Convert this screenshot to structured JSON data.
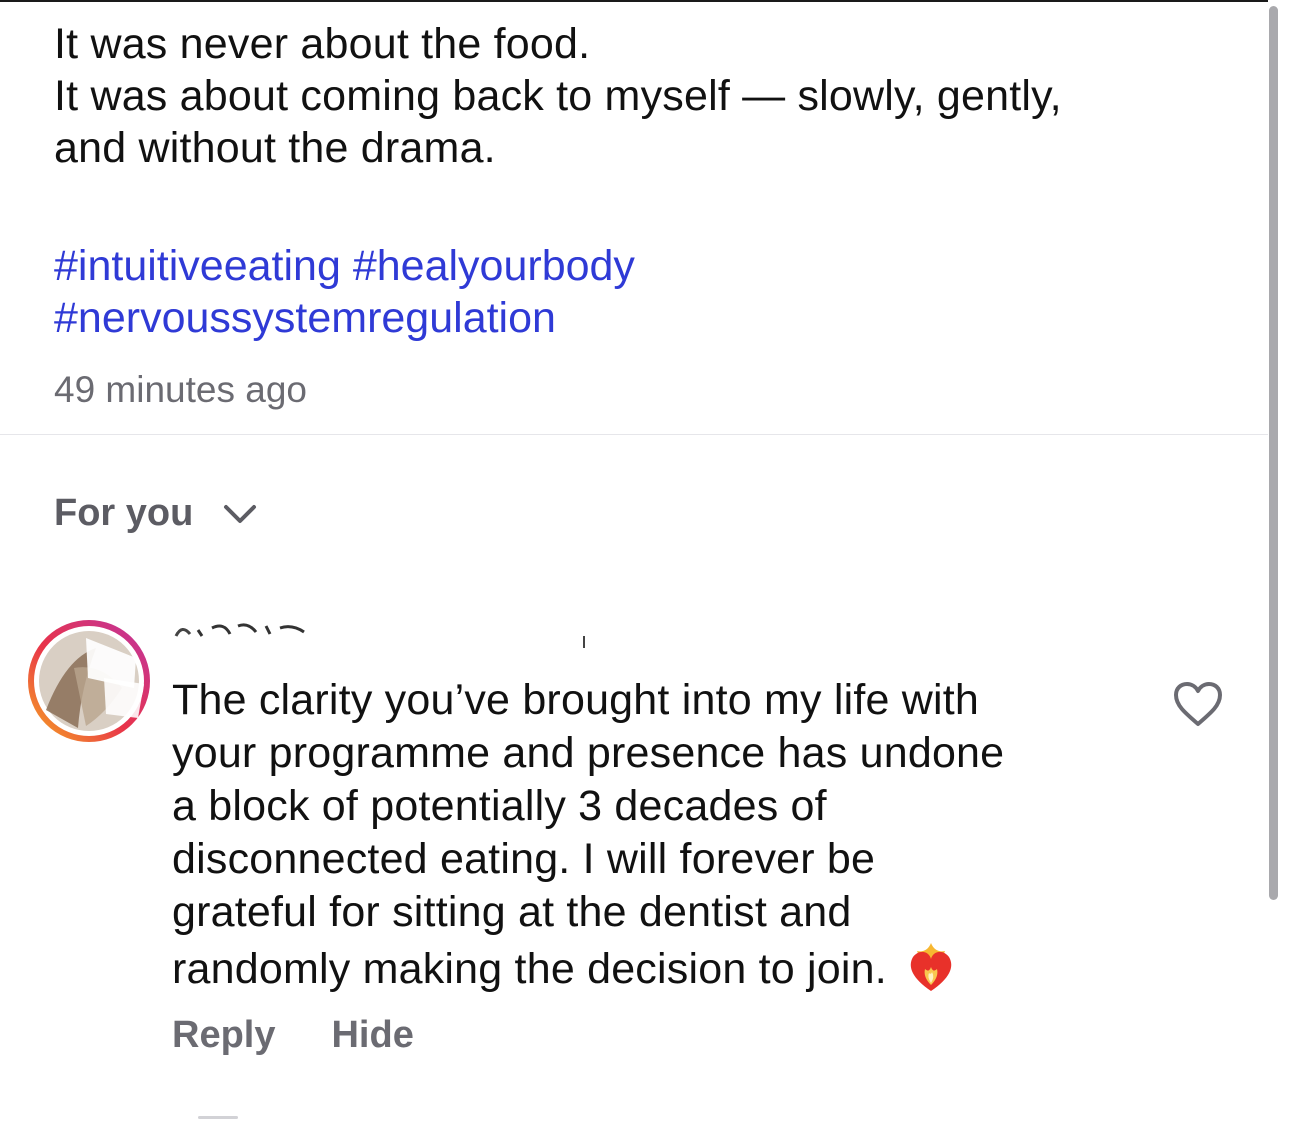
{
  "post": {
    "caption_lines": [
      "It was never about the food.",
      "It was about coming back to myself — slowly, gently,",
      "and without the drama."
    ],
    "hashtags": [
      "#intuitiveeating",
      "#healyourbody",
      "#nervoussystemregulation"
    ],
    "timestamp": "49 minutes ago"
  },
  "comments_header": {
    "sort_label": "For you",
    "icon": "chevron-down-icon"
  },
  "comment": {
    "text_lines": [
      "The clarity you’ve brought into my life with",
      "your programme and presence has undone",
      "a block of potentially 3 decades of",
      "disconnected eating. I will forever be",
      "grateful for sitting at the  dentist and",
      "randomly making the decision to join."
    ],
    "emoji": "heart-on-fire-emoji",
    "like_icon": "heart-outline-icon",
    "reply_label": "Reply",
    "hide_label": "Hide"
  },
  "colors": {
    "hashtag": "#2f3ad6",
    "muted_text": "#6b6b72",
    "divider": "#e6e6ea"
  }
}
